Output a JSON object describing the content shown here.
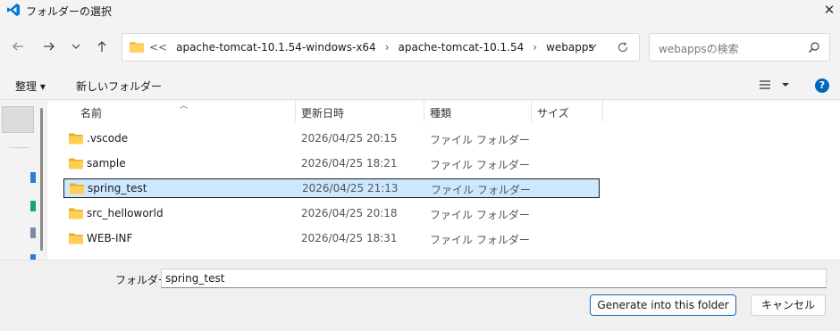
{
  "window": {
    "title": "フォルダーの選択",
    "app_icon": "vscode-icon",
    "close_icon": "close-icon"
  },
  "nav": {
    "back_icon": "back-arrow-icon",
    "forward_icon": "forward-arrow-icon",
    "recent_icon": "chevron-down-icon",
    "up_icon": "up-arrow-icon"
  },
  "address": {
    "overflow": "<<",
    "crumbs": [
      "apache-tomcat-10.1.54-windows-x64",
      "apache-tomcat-10.1.54",
      "webapps"
    ],
    "separator": "›"
  },
  "search": {
    "placeholder": "webappsの検索"
  },
  "toolbar": {
    "organize_label": "整理 ▾",
    "new_folder_label": "新しいフォルダー"
  },
  "columns": [
    "名前",
    "更新日時",
    "種類",
    "サイズ"
  ],
  "files": [
    {
      "name": ".vscode",
      "date": "2026/04/25 20:15",
      "type": "ファイル フォルダー",
      "selected": false
    },
    {
      "name": "sample",
      "date": "2026/04/25 18:21",
      "type": "ファイル フォルダー",
      "selected": false
    },
    {
      "name": "spring_test",
      "date": "2026/04/25 21:13",
      "type": "ファイル フォルダー",
      "selected": true
    },
    {
      "name": "src_helloworld",
      "date": "2026/04/25 20:18",
      "type": "ファイル フォルダー",
      "selected": false
    },
    {
      "name": "WEB-INF",
      "date": "2026/04/25 18:31",
      "type": "ファイル フォルダー",
      "selected": false
    }
  ],
  "footer": {
    "folder_label": "フォルダー:",
    "folder_value": "spring_test",
    "primary_button": "Generate into this folder",
    "cancel_button": "キャンセル"
  },
  "colors": {
    "accent": "#0067c0",
    "selection": "#cce8ff",
    "folder": "#f5c244"
  }
}
